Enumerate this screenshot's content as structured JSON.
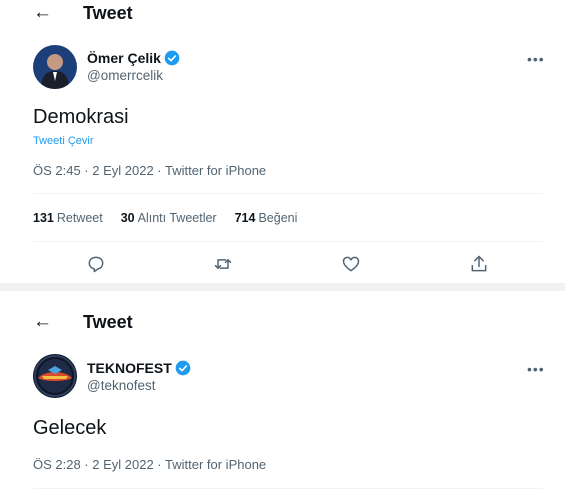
{
  "tweet1": {
    "header": {
      "back_icon": "←",
      "title": "Tweet"
    },
    "author": {
      "name": "Ömer Çelik",
      "handle": "@omerrcelik"
    },
    "more_icon": "•••",
    "text": "Demokrasi",
    "translate_label": "Tweeti Çevir",
    "meta": "ÖS 2:45 · 2 Eyl 2022 · Twitter for iPhone",
    "stats": [
      {
        "count": "131",
        "label": "Retweet"
      },
      {
        "count": "30",
        "label": "Alıntı Tweetler"
      },
      {
        "count": "714",
        "label": "Beğeni"
      }
    ],
    "actions": [
      "reply-icon",
      "retweet-icon",
      "like-icon",
      "share-icon"
    ]
  },
  "tweet2": {
    "header": {
      "back_icon": "←",
      "title": "Tweet"
    },
    "author": {
      "name": "TEKNOFEST",
      "handle": "@teknofest"
    },
    "more_icon": "•••",
    "text": "Gelecek",
    "meta": "ÖS 2:28 · 2 Eyl 2022 · Twitter for iPhone"
  },
  "colors": {
    "accent": "#1d9bf0",
    "text": "#0f1419",
    "secondary": "#536471",
    "divider": "#eff3f4"
  }
}
